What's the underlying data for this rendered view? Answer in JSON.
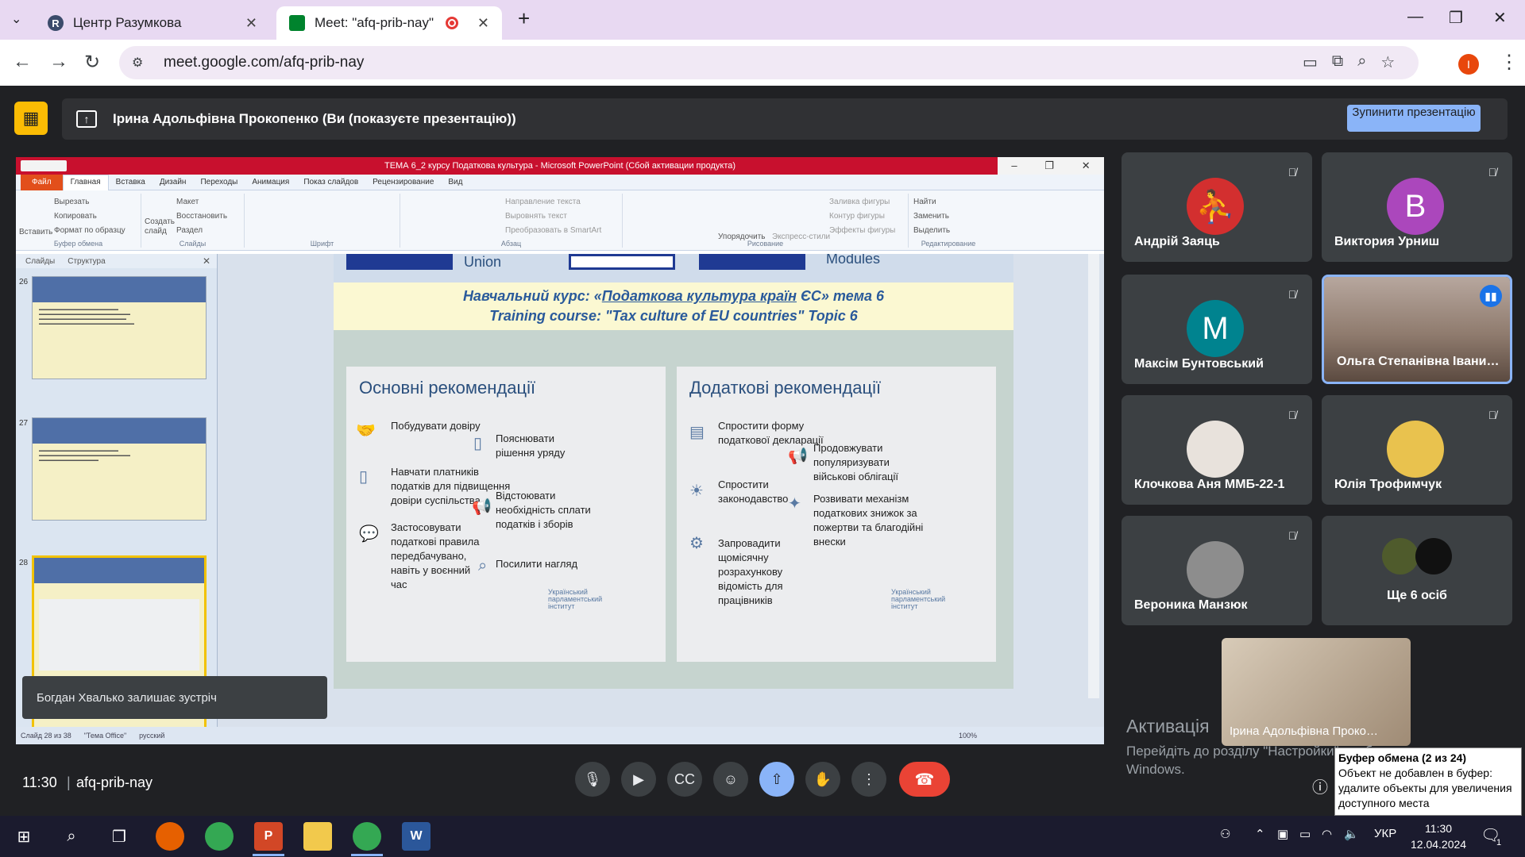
{
  "browser": {
    "tabs": [
      {
        "title": "Центр Разумкова",
        "icon_letter": "R"
      },
      {
        "title": "Meet: \"afq-prib-nay\""
      }
    ],
    "url": "meet.google.com/afq-prib-nay",
    "profile_letter": "I"
  },
  "presenting": {
    "title": "Ірина Адольфівна Прокопенко (Ви (показуєте презентацію))",
    "stop_label": "Зупинити презентацію"
  },
  "ppt": {
    "window_title": "ТЕМА 6_2 курсу Податкова культура - Microsoft PowerPoint (Сбой активации продукта)",
    "menu": [
      "Файл",
      "Главная",
      "Вставка",
      "Дизайн",
      "Переходы",
      "Анимация",
      "Показ слайдов",
      "Рецензирование",
      "Вид"
    ],
    "ribbon": {
      "clipboard": {
        "paste": "Вставить",
        "cut": "Вырезать",
        "copy": "Копировать",
        "format": "Формат по образцу",
        "label": "Буфер обмена"
      },
      "slides": {
        "create": "Создать слайд",
        "layout": "Макет",
        "reset": "Восстановить",
        "section": "Раздел",
        "label": "Слайды"
      },
      "font_label": "Шрифт",
      "paragraph": {
        "direction": "Направление текста",
        "align": "Выровнять текст",
        "smartart": "Преобразовать в SmartArt",
        "label": "Абзац"
      },
      "drawing": {
        "arrange": "Упорядочить",
        "quick": "Экспресс-стили",
        "fill": "Заливка фигуры",
        "outline": "Контур фигуры",
        "effects": "Эффекты фигуры",
        "label": "Рисование"
      },
      "editing": {
        "find": "Найти",
        "replace": "Заменить",
        "select": "Выделить",
        "label": "Редактирование"
      }
    },
    "panel_tabs": [
      "Слайды",
      "Структура"
    ],
    "thumbnails": [
      "26",
      "27",
      "28"
    ],
    "slide": {
      "top_text": [
        "Union",
        "Modules"
      ],
      "heading1_prefix": "Навчальний курс: «",
      "heading1_link": "Податкова культура країн",
      "heading1_suffix": " ЄС» тема 6",
      "heading2": "Training course: \"Tax culture of EU countries\" Topic 6",
      "left_title": "Основні рекомендації",
      "left_items": [
        "Побудувати довіру",
        "Пояснювати рішення уряду",
        "Навчати платників податків для підвищення довіри суспільства",
        "Відстоювати необхідність сплати податків і зборів",
        "Застосовувати податкові правила передбачувано, навіть у воєнний час",
        "Посилити нагляд"
      ],
      "right_title": "Додаткові рекомендації",
      "right_items": [
        "Спростити форму податкової декларації",
        "Продовжувати популяризувати військові облігації",
        "Спростити законодавство",
        "Розвивати механізм податкових знижок за пожертви та благодійні внески",
        "Запровадити щомісячну розрахункову відомість для працівників"
      ],
      "logo": "Український парламентський інститут"
    },
    "status": {
      "slide": "Слайд 28 из 38",
      "theme": "\"Тема Office\"",
      "lang": "русский",
      "zoom": "100%"
    }
  },
  "toast": "Богдан Хвалько залишає зустріч",
  "participants": [
    {
      "name": "Андрій Заяць",
      "initial": "",
      "color": "#d32f2f"
    },
    {
      "name": "Виктория Урниш",
      "initial": "B",
      "color": "#ab47bc"
    },
    {
      "name": "Максім Бунтовський",
      "initial": "M",
      "color": "#00838f"
    },
    {
      "name": "Ольга Степанівна Івани…"
    },
    {
      "name": "Клочкова Аня ММБ-22-1"
    },
    {
      "name": "Юлія Трофимчук"
    },
    {
      "name": "Вероника Манзюк"
    },
    {
      "name": "Ще 6 осіб"
    }
  ],
  "self_name": "Ірина Адольфівна Проко…",
  "activation": {
    "title": "Активація",
    "text": "Перейдіть до розділу \"Настройки\", щоб активувати Windows."
  },
  "clipboard_tip": {
    "title": "Буфер обмена (2 из 24)",
    "text": "Объект не добавлен в буфер: удалите объекты для увеличения доступного места"
  },
  "meet": {
    "time": "11:30",
    "code": "afq-prib-nay"
  },
  "taskbar": {
    "lang": "УКР",
    "time": "11:30",
    "date": "12.04.2024",
    "notif_count": "1"
  }
}
